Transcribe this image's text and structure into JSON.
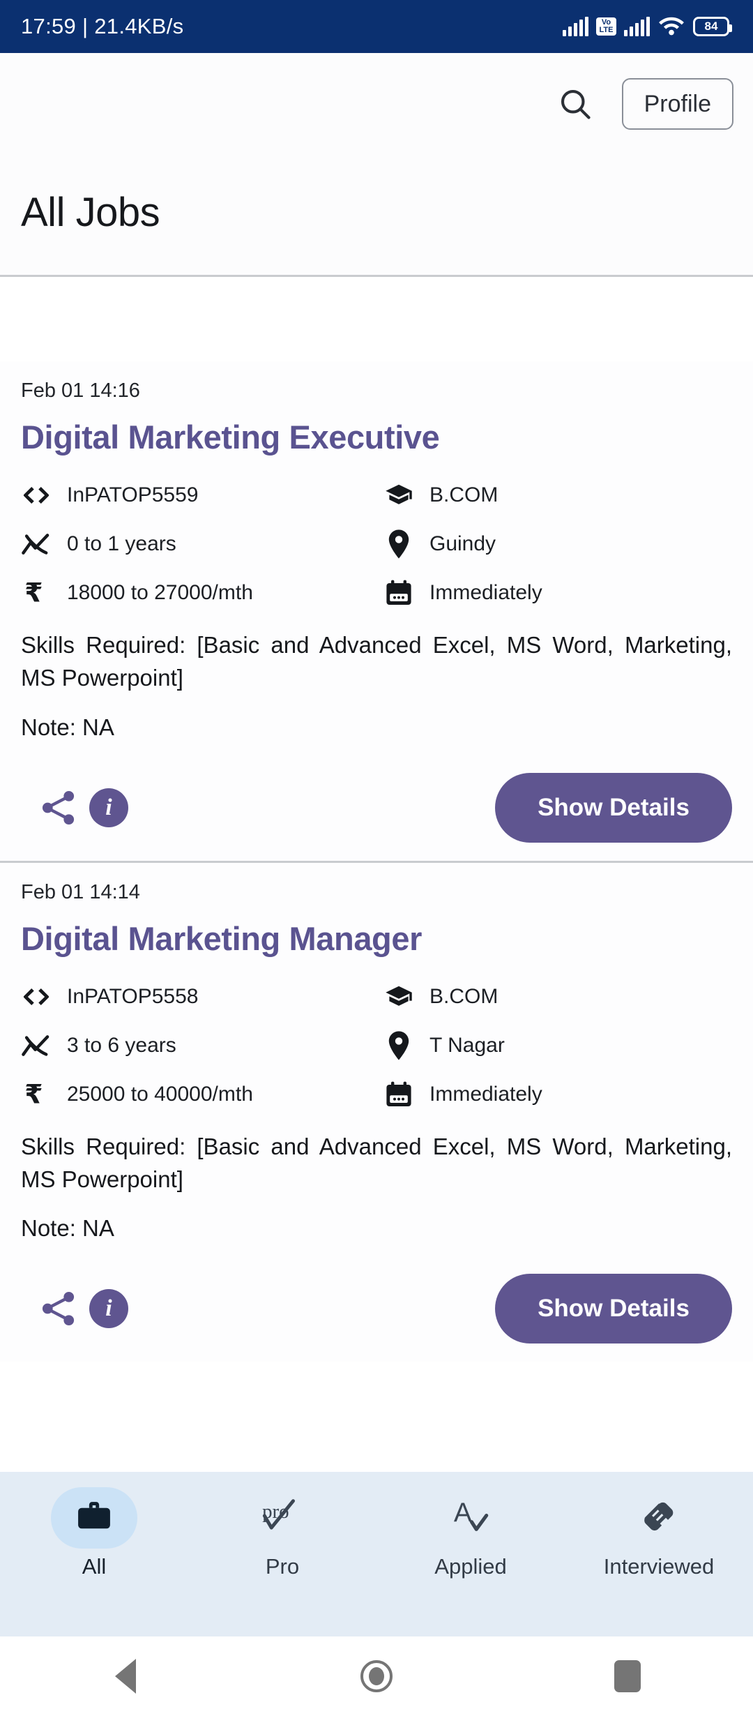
{
  "statusbar": {
    "time_and_speed": "17:59 | 21.4KB/s",
    "volte_top": "Vo",
    "volte_bottom": "LTE",
    "battery_level": "84"
  },
  "header": {
    "search_icon": "search-icon",
    "profile_label": "Profile",
    "page_title": "All Jobs"
  },
  "jobs": [
    {
      "date": "Feb 01 14:16",
      "title": "Digital Marketing Executive",
      "job_code": "InPATOP5559",
      "qualification": "B.COM",
      "experience": "0 to 1 years",
      "location": "Guindy",
      "salary": "18000 to 27000/mth",
      "joining": "Immediately",
      "skills": "Skills Required: [Basic and Advanced Excel, MS Word, Marketing, MS Powerpoint]",
      "note": "Note: NA",
      "share_icon": "share-icon",
      "info_icon": "info-icon",
      "details_label": "Show Details"
    },
    {
      "date": "Feb 01 14:14",
      "title": "Digital Marketing Manager",
      "job_code": "InPATOP5558",
      "qualification": "B.COM",
      "experience": "3 to 6 years",
      "location": "T Nagar",
      "salary": "25000 to 40000/mth",
      "joining": "Immediately",
      "skills": "Skills Required: [Basic and Advanced Excel, MS Word, Marketing, MS Powerpoint]",
      "note": "Note: NA",
      "share_icon": "share-icon",
      "info_icon": "info-icon",
      "details_label": "Show Details"
    }
  ],
  "bottom_nav": {
    "items": [
      {
        "label": "All",
        "icon": "briefcase-icon",
        "active": true
      },
      {
        "label": "Pro",
        "icon": "pro-check-icon",
        "active": false
      },
      {
        "label": "Applied",
        "icon": "a-check-icon",
        "active": false
      },
      {
        "label": "Interviewed",
        "icon": "handshake-icon",
        "active": false
      }
    ]
  },
  "android_nav": {
    "back": "back-triangle-icon",
    "home": "home-circle-icon",
    "recents": "recents-square-icon"
  },
  "colors": {
    "status_bar": "#0B3070",
    "accent_purple": "#5F5590",
    "nav_background": "#E3ECF5",
    "nav_active_pill": "#CBE2F6"
  }
}
